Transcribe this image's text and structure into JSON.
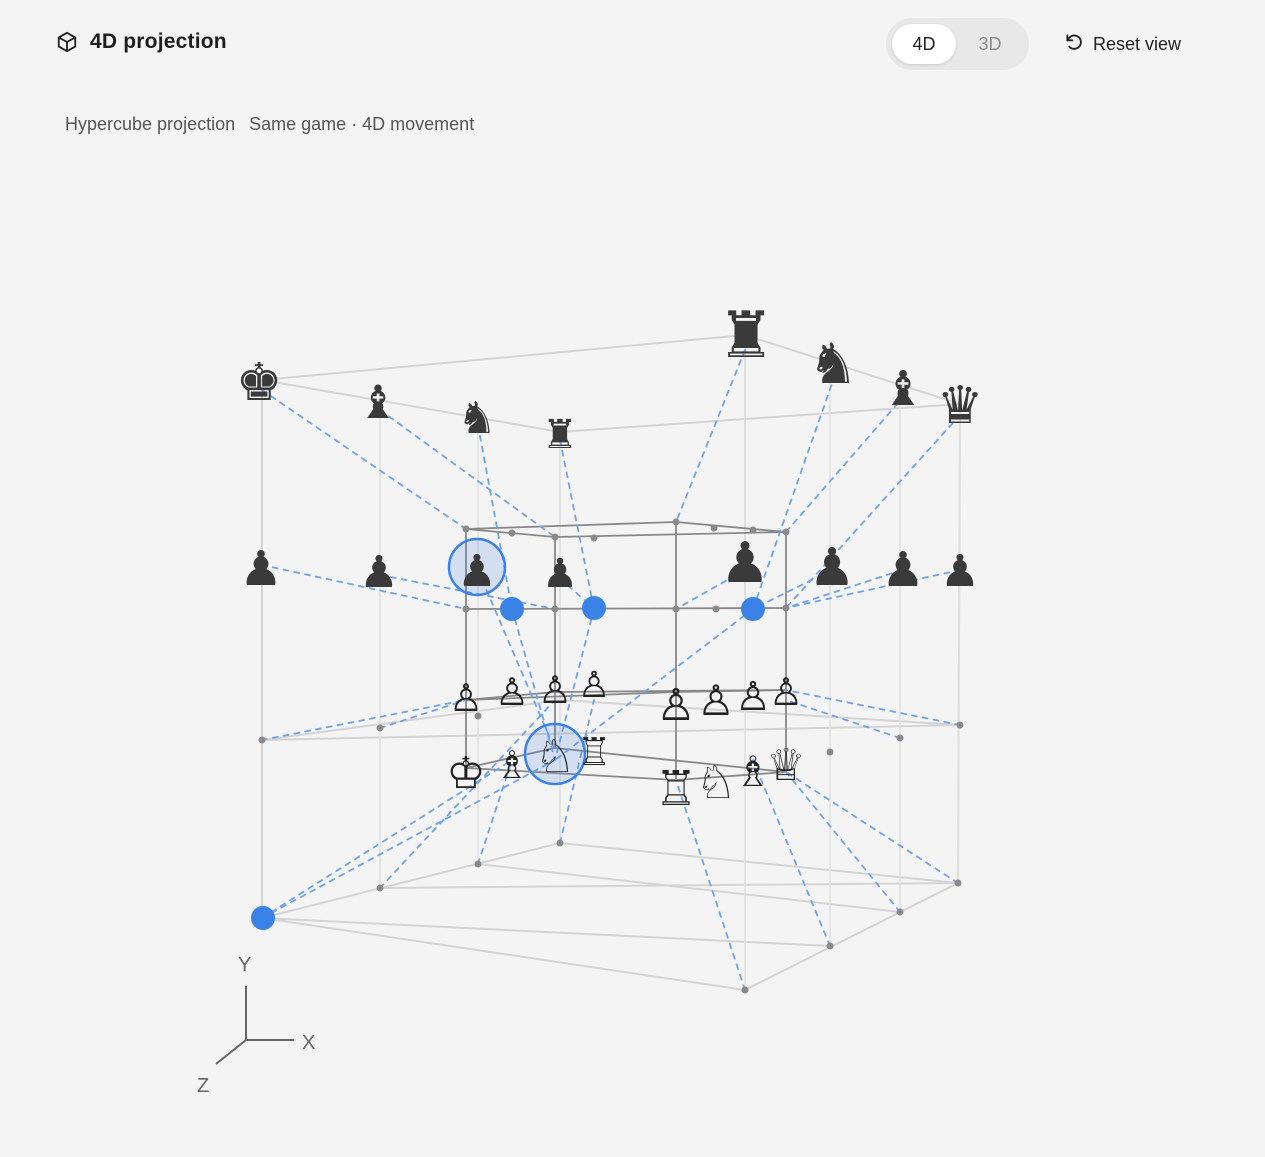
{
  "header": {
    "title": "4D projection",
    "title_icon": "cube-icon",
    "mode_options": [
      "4D",
      "3D"
    ],
    "active_mode": "4D",
    "reset_label": "Reset view",
    "reset_icon": "rotate-ccw-icon"
  },
  "subtitle": {
    "left": "Hypercube projection",
    "right": "Same game · 4D movement"
  },
  "axes": {
    "x": "X",
    "y": "Y",
    "z": "Z"
  },
  "colors": {
    "accent": "#3b82e6",
    "dark_piece": "#3a3a3a",
    "light_piece": "#ffffff",
    "edge": "#d4d4d4",
    "inner_edge": "#888888",
    "projection_line": "#6ea2ea"
  },
  "pieces": {
    "outer_top_black": [
      "king",
      "bishop",
      "knight",
      "rook",
      "rook",
      "knight",
      "bishop",
      "queen"
    ],
    "outer_mid_black": [
      "pawn",
      "pawn",
      "pawn",
      "pawn",
      "pawn",
      "pawn",
      "pawn",
      "pawn"
    ],
    "inner_white_pawns": [
      "pawn",
      "pawn",
      "pawn",
      "pawn",
      "pawn",
      "pawn",
      "pawn",
      "pawn"
    ],
    "inner_white_back": [
      "king",
      "bishop",
      "knight",
      "rook",
      "rook",
      "knight",
      "bishop",
      "queen"
    ]
  },
  "selection": {
    "selected_piece": "black pawn",
    "second_selected_piece": "white knight",
    "move_targets_count": 4
  }
}
